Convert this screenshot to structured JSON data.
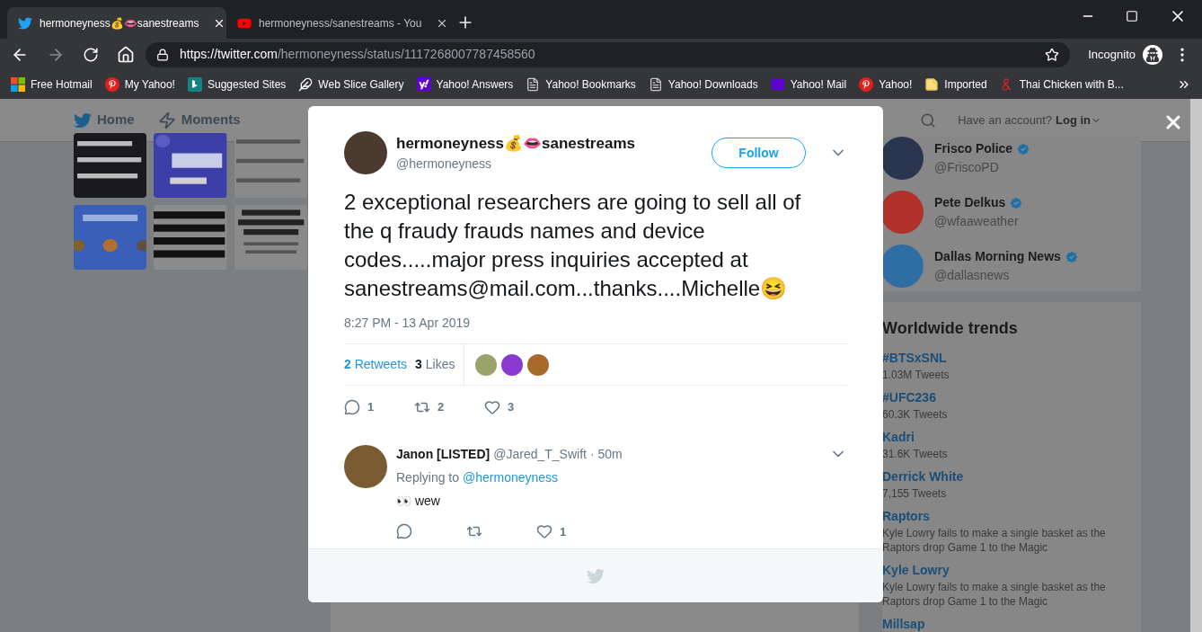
{
  "browser": {
    "tabs": [
      {
        "title": "hermoneyness💰👄sanestreams",
        "kind": "twitter",
        "selected": true
      },
      {
        "title": "hermoneyness/sanestreams - You",
        "kind": "youtube",
        "selected": false
      }
    ],
    "address": {
      "host": "https://twitter.com",
      "path": "/hermoneyness/status/1117268007787458560"
    },
    "profile": "Incognito",
    "bookmarks": [
      {
        "label": "Free Hotmail",
        "kind": "windows"
      },
      {
        "label": "My Yahoo!",
        "kind": "p-logo"
      },
      {
        "label": "Suggested Sites",
        "kind": "bing"
      },
      {
        "label": "Web Slice Gallery",
        "kind": "feather"
      },
      {
        "label": "Yahoo! Answers",
        "kind": "yahoo"
      },
      {
        "label": "Yahoo! Bookmarks",
        "kind": "page"
      },
      {
        "label": "Yahoo! Downloads",
        "kind": "page"
      },
      {
        "label": "Yahoo! Mail",
        "kind": "mail"
      },
      {
        "label": "Yahoo!",
        "kind": "p-logo"
      },
      {
        "label": "Imported",
        "kind": "note"
      },
      {
        "label": "Thai Chicken with B...",
        "kind": "ampersand"
      }
    ]
  },
  "header": {
    "nav": [
      {
        "label": "Home",
        "kind": "bird"
      },
      {
        "label": "Moments",
        "kind": "bolt"
      }
    ],
    "account_prompt": "Have an account?",
    "login": "Log in"
  },
  "tweet": {
    "name": "hermoneyness💰👄sanestreams",
    "handle": "@hermoneyness",
    "follow": "Follow",
    "text": "2 exceptional researchers are going to sell all of the q fraudy frauds names and device codes.....major press inquiries accepted at sanestreams@mail.com...thanks....Michelle😆",
    "time": "8:27 PM - 13 Apr 2019",
    "retweets": "**2** Retweets",
    "likes": "**3** Likes",
    "actions": [
      {
        "kind": "reply",
        "count": "1"
      },
      {
        "kind": "retweet",
        "count": "2"
      },
      {
        "kind": "like",
        "count": "3"
      }
    ]
  },
  "reply": {
    "name": "Janon [LISTED]",
    "handle": "@Jared_T_Swift",
    "time": "· 50m",
    "replying": "Replying to",
    "mention": "@hermoneyness",
    "text": "👀 wew",
    "actions": [
      {
        "kind": "reply"
      },
      {
        "kind": "retweet"
      },
      {
        "kind": "like",
        "count": "1"
      }
    ]
  },
  "sidebar": {
    "accounts": [
      {
        "name": "Frisco Police",
        "handle": "@FriscoPD",
        "color": "#2a3550"
      },
      {
        "name": "Pete Delkus",
        "handle": "@wfaaweather",
        "color": "#b0302a"
      },
      {
        "name": "Dallas Morning News",
        "handle": "@dallasnews",
        "color": "#2f6ea3"
      }
    ],
    "trends_title": "Worldwide trends",
    "trends": [
      {
        "name": "#BTSxSNL",
        "detail": "1.03M Tweets"
      },
      {
        "name": "#UFC236",
        "detail": "60.3K Tweets"
      },
      {
        "name": "Kadri",
        "detail": "31.6K Tweets"
      },
      {
        "name": "Derrick White",
        "detail": "7,155 Tweets"
      },
      {
        "name": "Raptors",
        "detail": "Kyle Lowry fails to make a single basket as the Raptors drop Game 1 to the Magic"
      },
      {
        "name": "Kyle Lowry",
        "detail": "Kyle Lowry fails to make a single basket as the Raptors drop Game 1 to the Magic"
      },
      {
        "name": "Millsap"
      }
    ]
  }
}
